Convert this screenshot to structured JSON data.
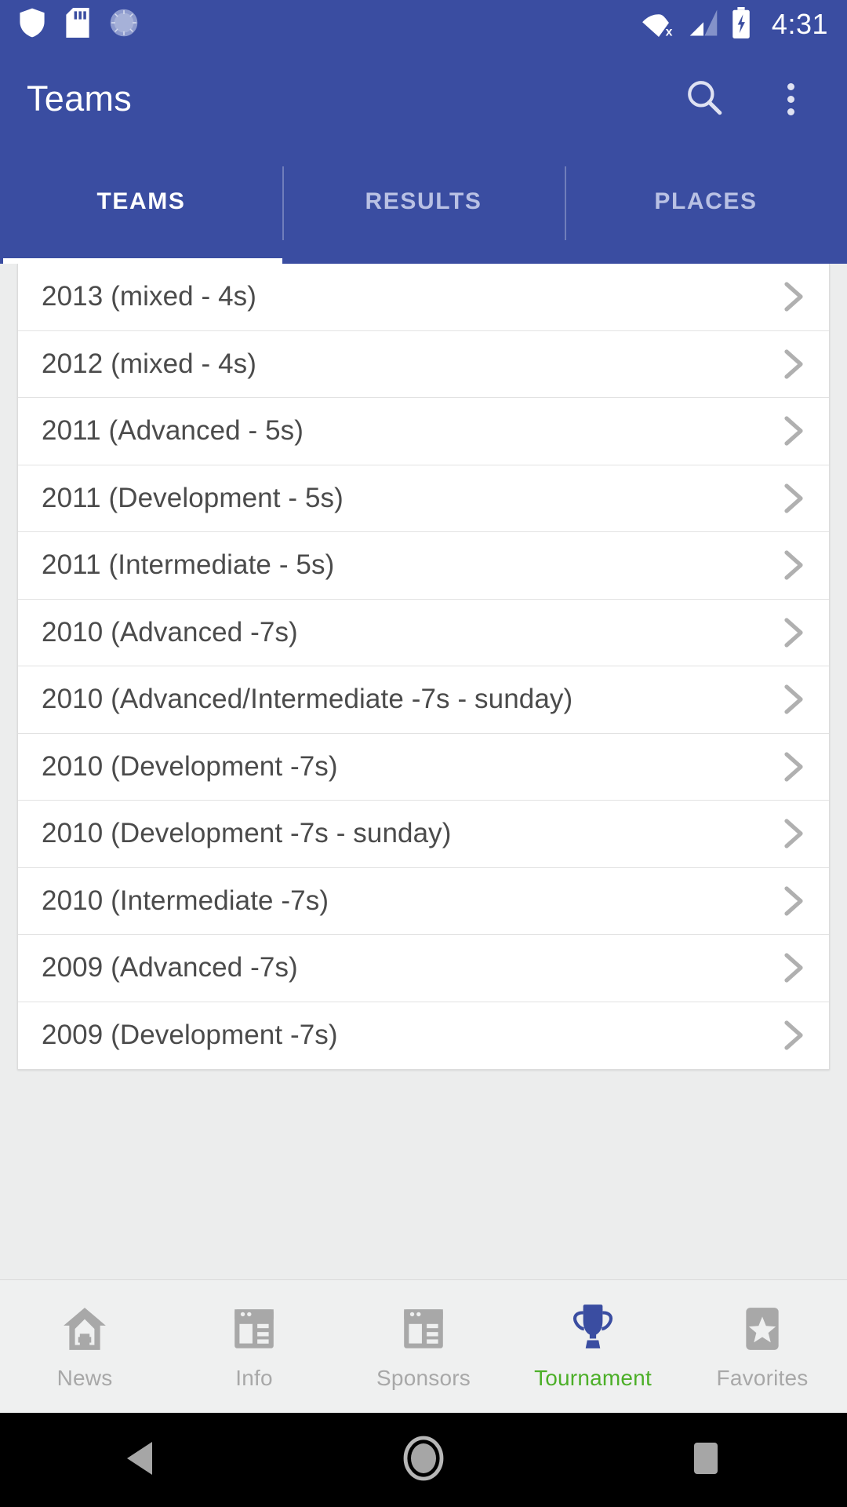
{
  "status_bar": {
    "time": "4:31",
    "icons": [
      "shield-icon",
      "sd-card-icon",
      "dial-icon",
      "wifi-off-icon",
      "cellular-signal-icon",
      "battery-charging-icon"
    ]
  },
  "app_bar": {
    "title": "Teams",
    "search_icon": "search-icon",
    "overflow_icon": "overflow-menu-icon"
  },
  "tabs": {
    "active_index": 0,
    "items": [
      {
        "label": "TEAMS"
      },
      {
        "label": "RESULTS"
      },
      {
        "label": "PLACES"
      }
    ]
  },
  "list": {
    "chevron_icon": "chevron-right-icon",
    "rows": [
      {
        "label": "2013 (mixed - 4s)"
      },
      {
        "label": "2012 (mixed - 4s)"
      },
      {
        "label": "2011 (Advanced - 5s)"
      },
      {
        "label": "2011 (Development - 5s)"
      },
      {
        "label": "2011 (Intermediate - 5s)"
      },
      {
        "label": "2010 (Advanced -7s)"
      },
      {
        "label": "2010 (Advanced/Intermediate -7s - sunday)"
      },
      {
        "label": "2010 (Development -7s)"
      },
      {
        "label": "2010 (Development -7s - sunday)"
      },
      {
        "label": "2010 (Intermediate -7s)"
      },
      {
        "label": "2009 (Advanced -7s)"
      },
      {
        "label": "2009 (Development -7s)"
      }
    ]
  },
  "bottom_nav": {
    "active_index": 3,
    "active_color": "#4caf28",
    "inactive_color": "#a8a8a8",
    "trophy_color": "#3a4da1",
    "items": [
      {
        "label": "News",
        "icon": "home-icon"
      },
      {
        "label": "Info",
        "icon": "article-icon"
      },
      {
        "label": "Sponsors",
        "icon": "article-icon"
      },
      {
        "label": "Tournament",
        "icon": "trophy-icon"
      },
      {
        "label": "Favorites",
        "icon": "star-icon"
      }
    ]
  },
  "system_nav": {
    "back": "back-triangle-icon",
    "home": "home-circle-icon",
    "recents": "recents-square-icon"
  },
  "colors": {
    "primary": "#3a4da1",
    "background": "#eceded",
    "row_text": "#4b4b4b"
  }
}
